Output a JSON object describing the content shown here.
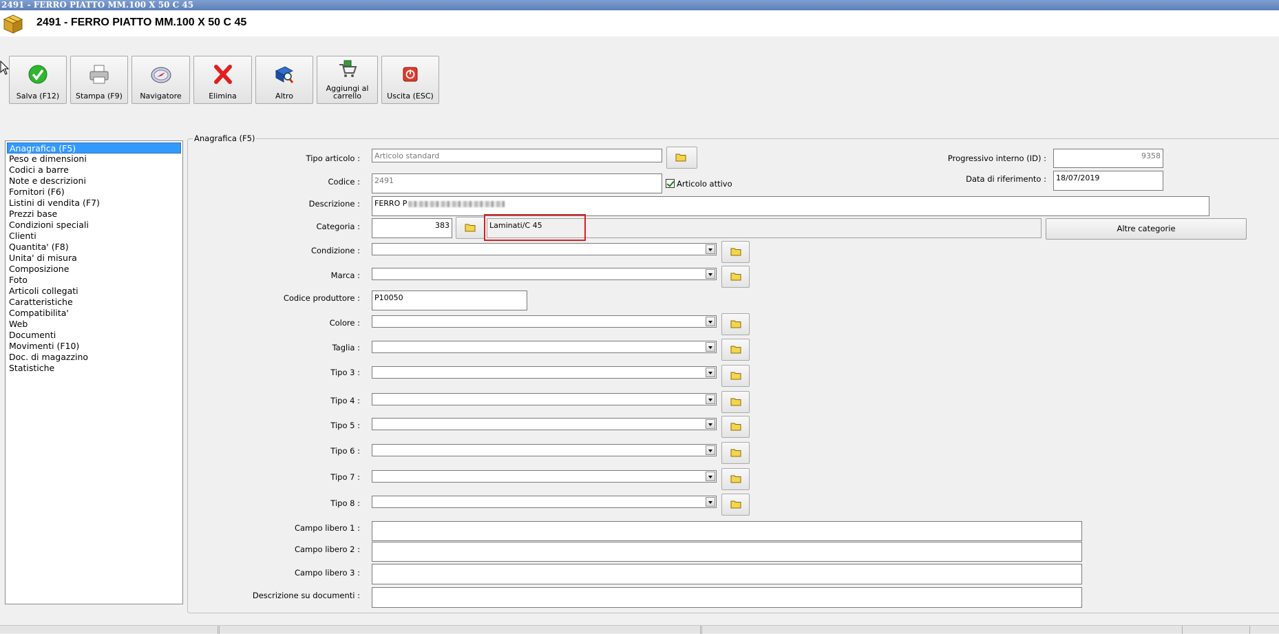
{
  "window": {
    "title": "2491 - FERRO PIATTO MM.100 X 50 C 45",
    "header_title": "2491 - FERRO PIATTO MM.100 X 50 C 45"
  },
  "toolbar": {
    "save": "Salva (F12)",
    "print": "Stampa (F9)",
    "navigator": "Navigatore",
    "delete": "Elimina",
    "other": "Altro",
    "add_cart_line1": "Aggiungi al",
    "add_cart_line2": "carrello",
    "exit": "Uscita (ESC)"
  },
  "nav": {
    "items": [
      "Anagrafica (F5)",
      "Peso e dimensioni",
      "Codici a barre",
      "Note e descrizioni",
      "Fornitori (F6)",
      "Listini di vendita (F7)",
      "Prezzi base",
      "Condizioni speciali",
      "Clienti",
      "Quantita' (F8)",
      "Unita' di misura",
      "Composizione",
      "Foto",
      "Articoli collegati",
      "Caratteristiche",
      "Compatibilita'",
      "Web",
      "Documenti",
      "Movimenti (F10)",
      "Doc. di magazzino",
      "Statistiche"
    ],
    "selected_index": 0
  },
  "form": {
    "group_title": "Anagrafica (F5)",
    "tipo_articolo": {
      "label": "Tipo articolo :",
      "value": "Articolo standard"
    },
    "codice": {
      "label": "Codice :",
      "value": "2491"
    },
    "articolo_attivo": {
      "label": "Articolo attivo",
      "checked": true
    },
    "descrizione": {
      "label": "Descrizione :",
      "value": "FERRO P"
    },
    "categoria": {
      "label": "Categoria :",
      "code": "383",
      "name": "Laminati/C 45"
    },
    "altre_categorie": "Altre categorie",
    "progressivo": {
      "label": "Progressivo interno (ID) :",
      "value": "9358"
    },
    "data_riferimento": {
      "label": "Data di riferimento :",
      "value": "18/07/2019"
    },
    "condizione": {
      "label": "Condizione :",
      "value": ""
    },
    "marca": {
      "label": "Marca :",
      "value": ""
    },
    "codice_produttore": {
      "label": "Codice produttore :",
      "value": "P10050"
    },
    "colore": {
      "label": "Colore :",
      "value": ""
    },
    "taglia": {
      "label": "Taglia :",
      "value": ""
    },
    "tipo3": {
      "label": "Tipo 3 :",
      "value": ""
    },
    "tipo4": {
      "label": "Tipo 4 :",
      "value": ""
    },
    "tipo5": {
      "label": "Tipo 5 :",
      "value": ""
    },
    "tipo6": {
      "label": "Tipo 6 :",
      "value": ""
    },
    "tipo7": {
      "label": "Tipo 7 :",
      "value": ""
    },
    "tipo8": {
      "label": "Tipo 8 :",
      "value": ""
    },
    "campo1": {
      "label": "Campo libero 1 :",
      "value": ""
    },
    "campo2": {
      "label": "Campo libero 2 :",
      "value": ""
    },
    "campo3": {
      "label": "Campo libero 3 :",
      "value": ""
    },
    "desc_documenti": {
      "label": "Descrizione su documenti :",
      "value": ""
    }
  },
  "colors": {
    "selection": "#3399ff",
    "highlight_box": "#d32020",
    "titlebar": "#5c80b9"
  }
}
